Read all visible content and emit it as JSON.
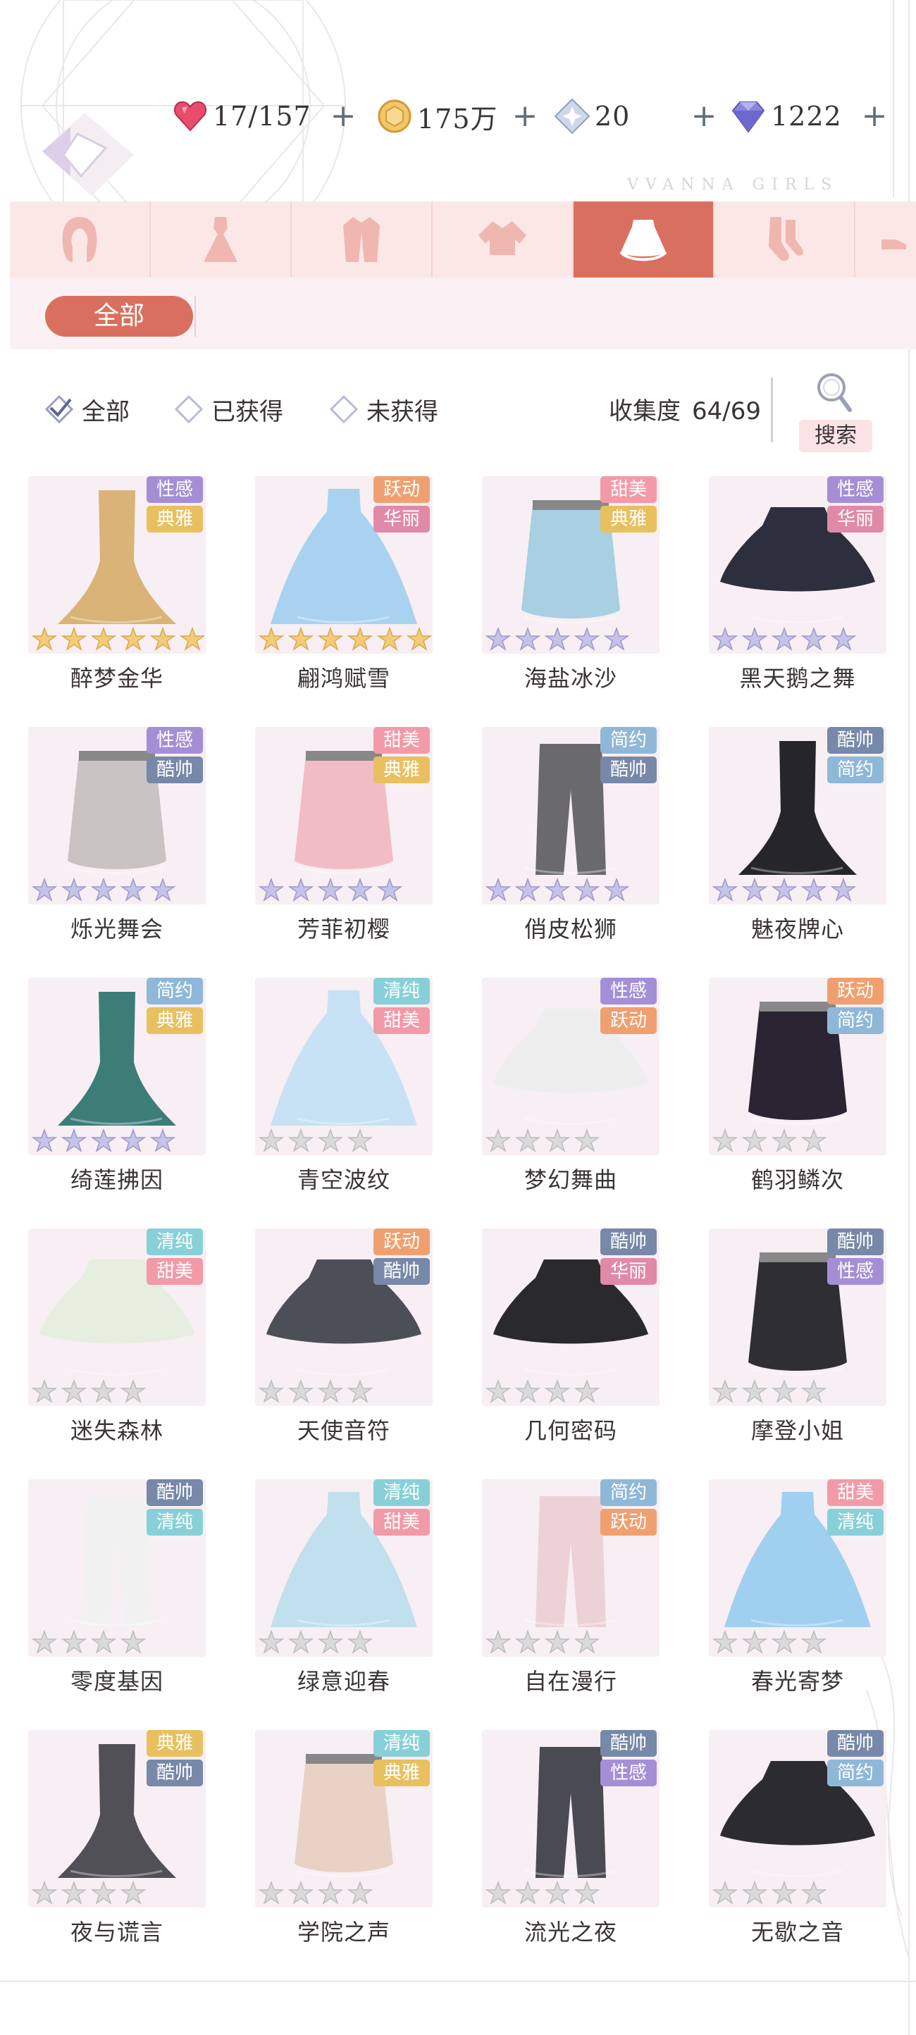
{
  "currencies": [
    {
      "icon": "stamina-heart-icon",
      "value": "17/157"
    },
    {
      "icon": "gold-coin-icon",
      "value": "175万"
    },
    {
      "icon": "star-crystal-icon",
      "value": "20"
    },
    {
      "icon": "diamond-icon",
      "value": "1222"
    }
  ],
  "plus_label": "+",
  "watermark": "VVANNA GIRLS",
  "categories": [
    {
      "icon": "hair-icon",
      "active": false
    },
    {
      "icon": "dress-icon",
      "active": false
    },
    {
      "icon": "coat-icon",
      "active": false
    },
    {
      "icon": "top-icon",
      "active": false
    },
    {
      "icon": "skirt-icon",
      "active": true
    },
    {
      "icon": "socks-icon",
      "active": false
    }
  ],
  "subtab_all": "全部",
  "filters": [
    {
      "label": "全部",
      "checked": true
    },
    {
      "label": "已获得",
      "checked": false
    },
    {
      "label": "未获得",
      "checked": false
    }
  ],
  "collection": {
    "label": "收集度",
    "value": "64/69"
  },
  "search_label": "搜索",
  "tag_colors": {
    "性感": "#a48fd6",
    "典雅": "#e8c060",
    "跃动": "#f0a070",
    "华丽": "#e08aa8",
    "甜美": "#f29aa8",
    "酷帅": "#7788a8",
    "简约": "#8fb8d8",
    "清纯": "#88d0d8"
  },
  "items": [
    {
      "name": "醉梦金华",
      "tags": [
        "性感",
        "典雅"
      ],
      "stars": 6,
      "star_color": "gold",
      "color": "#d9b377"
    },
    {
      "name": "翩鸿赋雪",
      "tags": [
        "跃动",
        "华丽"
      ],
      "stars": 6,
      "star_color": "gold",
      "color": "#a9d1f0"
    },
    {
      "name": "海盐冰沙",
      "tags": [
        "甜美",
        "典雅"
      ],
      "stars": 5,
      "star_color": "purple",
      "color": "#a8cfe2"
    },
    {
      "name": "黑天鹅之舞",
      "tags": [
        "性感",
        "华丽"
      ],
      "stars": 5,
      "star_color": "purple",
      "color": "#2d2f3e"
    },
    {
      "name": "烁光舞会",
      "tags": [
        "性感",
        "酷帅"
      ],
      "stars": 5,
      "star_color": "purple",
      "color": "#c9c3c4"
    },
    {
      "name": "芳菲初樱",
      "tags": [
        "甜美",
        "典雅"
      ],
      "stars": 5,
      "star_color": "purple",
      "color": "#f2bcc6"
    },
    {
      "name": "俏皮松狮",
      "tags": [
        "简约",
        "酷帅"
      ],
      "stars": 5,
      "star_color": "purple",
      "color": "#6a6a6c"
    },
    {
      "name": "魅夜牌心",
      "tags": [
        "酷帅",
        "简约"
      ],
      "stars": 5,
      "star_color": "purple",
      "color": "#26262a"
    },
    {
      "name": "绮莲拂因",
      "tags": [
        "简约",
        "典雅"
      ],
      "stars": 5,
      "star_color": "purple",
      "color": "#3d7d78"
    },
    {
      "name": "青空波纹",
      "tags": [
        "清纯",
        "甜美"
      ],
      "stars": 4,
      "star_color": "silver",
      "color": "#c6e2f4"
    },
    {
      "name": "梦幻舞曲",
      "tags": [
        "性感",
        "跃动"
      ],
      "stars": 4,
      "star_color": "silver",
      "color": "#eeeeee"
    },
    {
      "name": "鹤羽鳞次",
      "tags": [
        "跃动",
        "简约"
      ],
      "stars": 4,
      "star_color": "silver",
      "color": "#2b2433"
    },
    {
      "name": "迷失森林",
      "tags": [
        "清纯",
        "甜美"
      ],
      "stars": 4,
      "star_color": "silver",
      "color": "#e6eee0"
    },
    {
      "name": "天使音符",
      "tags": [
        "跃动",
        "酷帅"
      ],
      "stars": 4,
      "star_color": "silver",
      "color": "#4d4f58"
    },
    {
      "name": "几何密码",
      "tags": [
        "酷帅",
        "华丽"
      ],
      "stars": 4,
      "star_color": "silver",
      "color": "#2a2a2c"
    },
    {
      "name": "摩登小姐",
      "tags": [
        "酷帅",
        "性感"
      ],
      "stars": 4,
      "star_color": "silver",
      "color": "#2f2f33"
    },
    {
      "name": "零度基因",
      "tags": [
        "酷帅",
        "清纯"
      ],
      "stars": 4,
      "star_color": "silver",
      "color": "#f1f1f1"
    },
    {
      "name": "绿意迎春",
      "tags": [
        "清纯",
        "甜美"
      ],
      "stars": 4,
      "star_color": "silver",
      "color": "#bfe0ec"
    },
    {
      "name": "自在漫行",
      "tags": [
        "简约",
        "跃动"
      ],
      "stars": 4,
      "star_color": "silver",
      "color": "#ecd2d6"
    },
    {
      "name": "春光寄梦",
      "tags": [
        "甜美",
        "清纯"
      ],
      "stars": 4,
      "star_color": "silver",
      "color": "#9fd0f0"
    },
    {
      "name": "夜与谎言",
      "tags": [
        "典雅",
        "酷帅"
      ],
      "stars": 4,
      "star_color": "silver",
      "color": "#505056"
    },
    {
      "name": "学院之声",
      "tags": [
        "清纯",
        "典雅"
      ],
      "stars": 4,
      "star_color": "silver",
      "color": "#e8d2c6"
    },
    {
      "name": "流光之夜",
      "tags": [
        "酷帅",
        "性感"
      ],
      "stars": 4,
      "star_color": "silver",
      "color": "#4a4a52"
    },
    {
      "name": "无歇之音",
      "tags": [
        "酷帅",
        "简约"
      ],
      "stars": 4,
      "star_color": "silver",
      "color": "#2c2c30"
    }
  ]
}
